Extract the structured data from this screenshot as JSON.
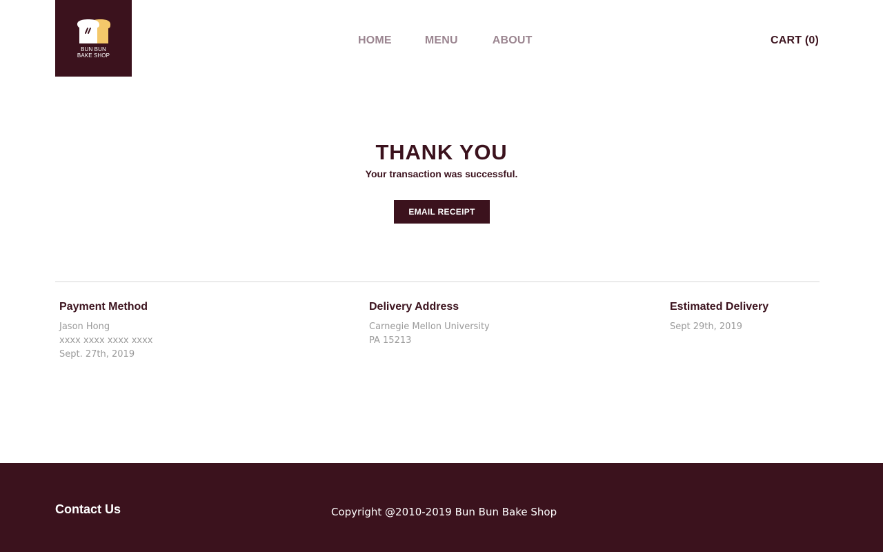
{
  "header": {
    "logo": {
      "line1": "BUN BUN",
      "line2": "BAKE SHOP",
      "icon": "bread-logo-icon"
    },
    "nav": {
      "home": "HOME",
      "menu": "MENU",
      "about": "ABOUT"
    },
    "cart": "CART (0)"
  },
  "main": {
    "title": "THANK YOU",
    "subtitle": "Your transaction was successful.",
    "email_button": "EMAIL RECEIPT",
    "payment": {
      "heading": "Payment Method",
      "name": "Jason Hong",
      "card": "xxxx xxxx xxxx xxxx",
      "date": "Sept. 27th, 2019"
    },
    "address": {
      "heading": "Delivery Address",
      "line1": "Carnegie Mellon University",
      "line2": "PA 15213"
    },
    "delivery": {
      "heading": "Estimated Delivery",
      "date": "Sept 29th, 2019"
    }
  },
  "footer": {
    "contact": "Contact Us",
    "copyright": "Copyright @2010-2019 Bun Bun Bake Shop"
  },
  "colors": {
    "brand": "#3b121d",
    "nav_text": "#9b8590",
    "muted_text": "#9a9a9a",
    "bread_accent": "#f4c86a"
  }
}
